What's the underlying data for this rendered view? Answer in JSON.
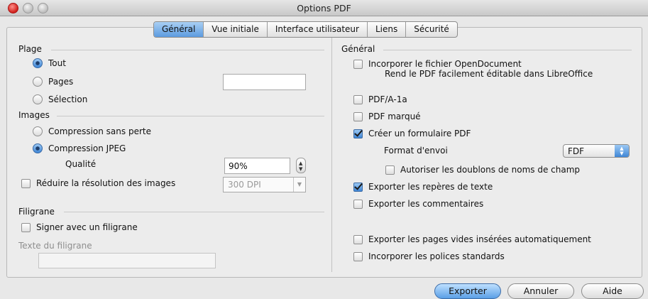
{
  "window": {
    "title": "Options PDF"
  },
  "tabs": [
    "Général",
    "Vue initiale",
    "Interface utilisateur",
    "Liens",
    "Sécurité"
  ],
  "left": {
    "plage": {
      "title": "Plage",
      "tout": "Tout",
      "pages": "Pages",
      "pages_value": "",
      "selection": "Sélection"
    },
    "images": {
      "title": "Images",
      "lossless": "Compression sans perte",
      "jpeg": "Compression JPEG",
      "quality_label": "Qualité",
      "quality_value": "90%",
      "reduce_label": "Réduire la résolution des images",
      "reduce_value": "300 DPI"
    },
    "filigrane": {
      "title": "Filigrane",
      "sign": "Signer avec un filigrane",
      "text_label": "Texte du filigrane",
      "text_value": ""
    }
  },
  "right": {
    "title": "Général",
    "embed_odf": "Incorporer le fichier OpenDocument",
    "embed_odf_desc": "Rend le PDF facilement éditable dans LibreOffice",
    "pdfa": "PDF/A-1a",
    "tagged": "PDF marqué",
    "create_form": "Créer un formulaire PDF",
    "submit_format_label": "Format d'envoi",
    "submit_format_value": "FDF",
    "allow_duplicates": "Autoriser les doublons de noms de champ",
    "export_bookmarks": "Exporter les repères de texte",
    "export_comments": "Exporter les commentaires",
    "export_empty_pages": "Exporter les pages vides insérées automatiquement",
    "embed_fonts": "Incorporer les polices standards"
  },
  "buttons": {
    "export": "Exporter",
    "cancel": "Annuler",
    "help": "Aide"
  },
  "states": {
    "plage_selected": "Tout",
    "images_selected": "Compression JPEG",
    "create_form_checked": true,
    "export_bookmarks_checked": true
  }
}
